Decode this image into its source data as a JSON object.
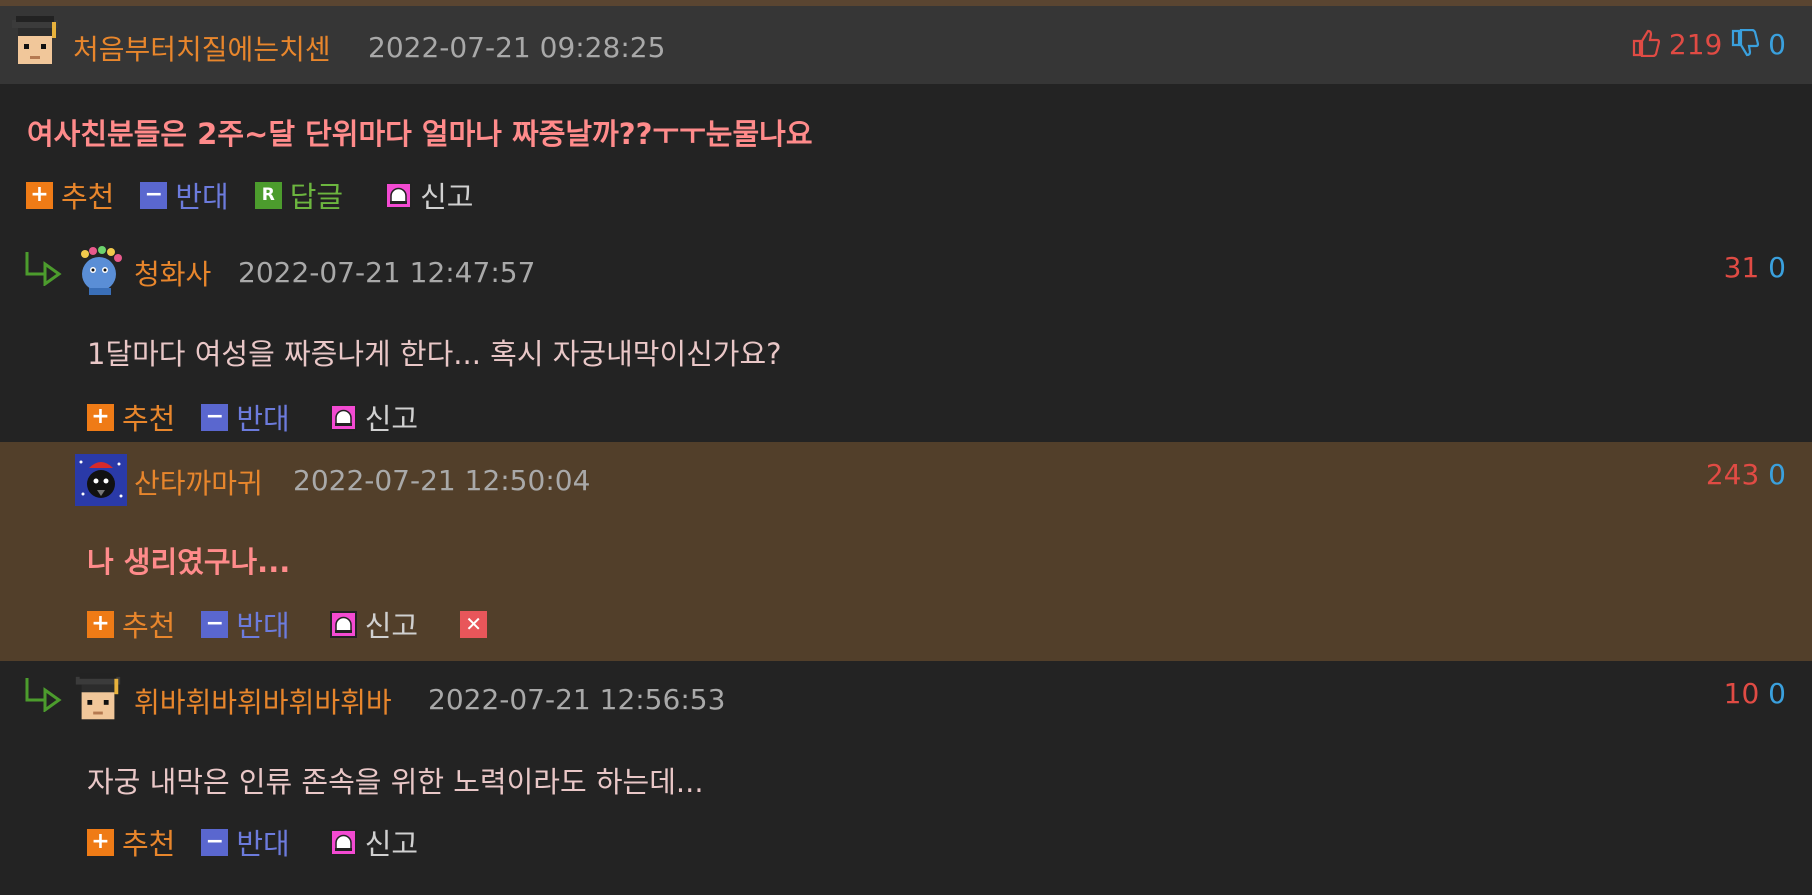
{
  "comments": [
    {
      "nickname": "처음부터치질에는치센",
      "date": "2022-07-21 09:28:25",
      "up": "219",
      "down": "0",
      "text": "여사친분들은 2주~달 단위마다 얼마나 짜증날까??ㅜㅜ눈물나요",
      "avatar_icon": "graduate-avatar-icon"
    },
    {
      "nickname": "청화사",
      "date": "2022-07-21 12:47:57",
      "up": "31",
      "down": "0",
      "text": "1달마다 여성을 짜증나게 한다... 혹시 자궁내막이신가요?",
      "avatar_icon": "blue-creature-avatar-icon"
    },
    {
      "nickname": "산타까마귀",
      "date": "2022-07-21 12:50:04",
      "up": "243",
      "down": "0",
      "text": "나 생리였구나...",
      "avatar_icon": "santa-crow-avatar-icon"
    },
    {
      "nickname": "휘바휘바휘바휘바휘바",
      "date": "2022-07-21 12:56:53",
      "up": "10",
      "down": "0",
      "text": "자궁 내막은 인류 존속을 위한 노력이라도 하는데...",
      "avatar_icon": "graduate-avatar-icon"
    }
  ],
  "actions": {
    "recommend": "추천",
    "oppose": "반대",
    "reply": "답글",
    "report": "신고"
  },
  "icons": {
    "plus": "+",
    "minus": "−",
    "reply_letter": "R",
    "delete": "✕"
  },
  "colors": {
    "background": "#232323",
    "header": "#363636",
    "highlight_bg": "#523f2a",
    "nickname": "#e8862c",
    "up": "#e04b44",
    "down": "#3aa0dd"
  }
}
